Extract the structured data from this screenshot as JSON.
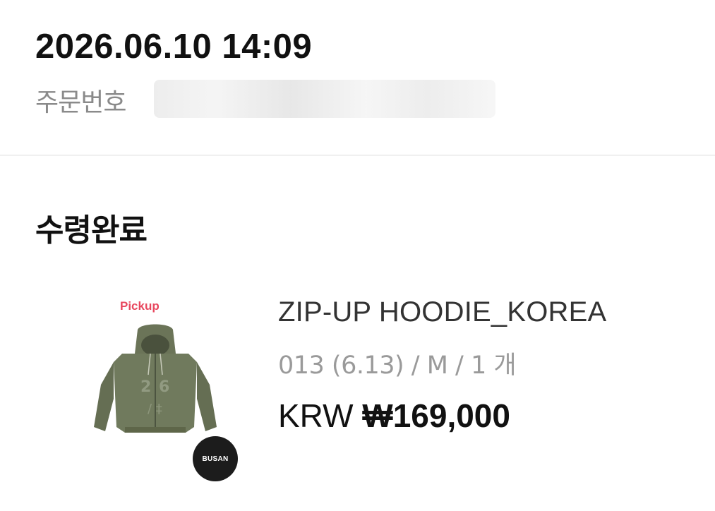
{
  "order": {
    "datetime": "2026.06.10 14:09",
    "number_label": "주문번호"
  },
  "status": {
    "title": "수령완료"
  },
  "product": {
    "thumbnail": {
      "pickup_label": "Pickup",
      "location_badge": "BUSAN"
    },
    "name": "ZIP-UP HOODIE_KOREA",
    "options": "013 (6.13) / M / 1 개",
    "price": {
      "currency": "KRW",
      "amount": "₩169,000"
    }
  },
  "colors": {
    "pickup_label": "#e8475e",
    "hoodie": "#6b7458",
    "badge": "#1c1c1c",
    "secondary_text": "#8a8a8a"
  }
}
